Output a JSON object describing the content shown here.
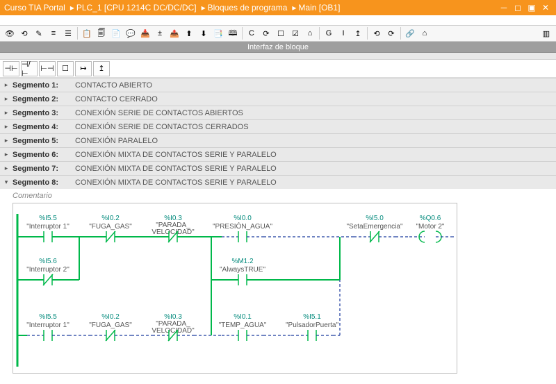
{
  "titlebar": {
    "crumbs": [
      "Curso TIA Portal",
      "PLC_1 [CPU 1214C DC/DC/DC]",
      "Bloques de programa",
      "Main [OB1]"
    ]
  },
  "interfaceBar": "Interfaz de bloque",
  "ladderTools": [
    "⊣⊢",
    "⊣/⊢",
    "⊢⊣",
    "☐",
    "↦",
    "↥"
  ],
  "segments": [
    {
      "n": "Segmento 1:",
      "d": "CONTACTO ABIERTO",
      "open": false
    },
    {
      "n": "Segmento 2:",
      "d": "CONTACTO CERRADO",
      "open": false
    },
    {
      "n": "Segmento 3:",
      "d": "CONEXIÓN SERIE DE CONTACTOS ABIERTOS",
      "open": false
    },
    {
      "n": "Segmento 4:",
      "d": "CONEXIÓN SERIE DE CONTACTOS CERRADOS",
      "open": false
    },
    {
      "n": "Segmento 5:",
      "d": "CONEXIÓN PARALELO",
      "open": false
    },
    {
      "n": "Segmento 6:",
      "d": "CONEXIÓN MIXTA DE CONTACTOS SERIE Y PARALELO",
      "open": false
    },
    {
      "n": "Segmento 7:",
      "d": "CONEXIÓN MIXTA DE CONTACTOS SERIE Y PARALELO",
      "open": false
    },
    {
      "n": "Segmento 8:",
      "d": "CONEXIÓN MIXTA DE CONTACTOS SERIE Y PARALELO",
      "open": true
    }
  ],
  "commentPlaceholder": "Comentario",
  "ladder": {
    "row1": [
      {
        "addr": "%I5.5",
        "name": "\"Interruptor 1\"",
        "type": "no",
        "on": true
      },
      {
        "addr": "%I0.2",
        "name": "\"FUGA_GAS\"",
        "type": "nc",
        "on": true
      },
      {
        "addr": "%I0.3",
        "name": "\"PARADA_VELOCIDAD\"",
        "type": "nc",
        "on": true
      },
      {
        "addr": "%I0.0",
        "name": "\"PRESIÓN_AGUA\"",
        "type": "no",
        "on": false
      },
      {
        "addr": "%I5.0",
        "name": "\"SetaEmergencia\"",
        "type": "nc",
        "on": false
      },
      {
        "addr": "%Q0.6",
        "name": "\"Motor 2\"",
        "type": "coil",
        "on": false
      }
    ],
    "row2": [
      {
        "addr": "%I5.6",
        "name": "\"Interruptor 2\"",
        "type": "nc",
        "on": true
      },
      {
        "addr": "%M1.2",
        "name": "\"AlwaysTRUE\"",
        "type": "no",
        "on": true
      }
    ],
    "row3": [
      {
        "addr": "%I5.5",
        "name": "\"Interruptor 1\"",
        "type": "no",
        "on": false
      },
      {
        "addr": "%I0.2",
        "name": "\"FUGA_GAS\"",
        "type": "nc",
        "on": false
      },
      {
        "addr": "%I0.3",
        "name": "\"PARADA_VELOCIDAD\"",
        "type": "nc",
        "on": false
      },
      {
        "addr": "%I0.1",
        "name": "\"TEMP_AGUA\"",
        "type": "no",
        "on": false
      },
      {
        "addr": "%I5.1",
        "name": "\"PulsadorPuerta\"",
        "type": "no",
        "on": false
      }
    ]
  }
}
